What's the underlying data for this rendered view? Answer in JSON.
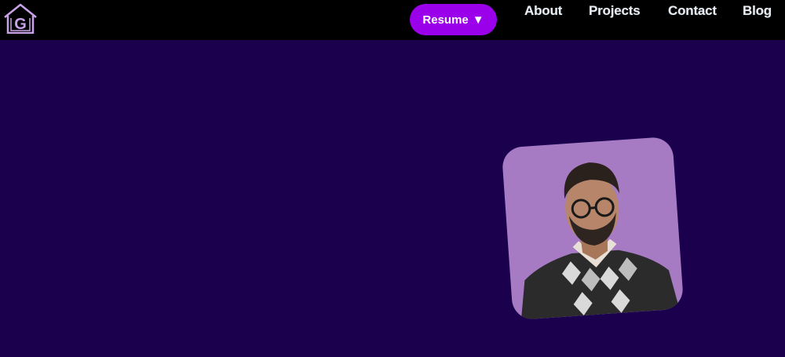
{
  "header": {
    "logo": {
      "icon": "home-g-logo-icon",
      "letter": "G",
      "color": "#c8a2e8"
    },
    "resume_label": "Resume",
    "resume_caret": "▼",
    "nav": [
      {
        "label": "About"
      },
      {
        "label": "Projects"
      },
      {
        "label": "Contact"
      },
      {
        "label": "Blog"
      }
    ]
  },
  "colors": {
    "navbar_bg": "#000000",
    "page_bg": "#1a004d",
    "accent": "#9a00ea",
    "photo_bg": "#a67bc4"
  },
  "hero": {
    "photo": {
      "icon": "profile-photo",
      "subject": "person-with-glasses"
    }
  }
}
